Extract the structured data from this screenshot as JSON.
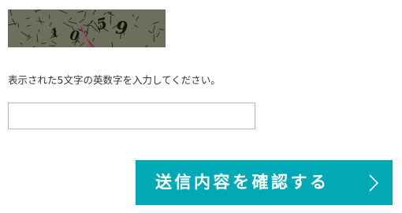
{
  "captcha": {
    "text": "1059",
    "background_color": "#6e6e5c",
    "noise_color": "#1e1e16",
    "accent_line_color": "#c2185b"
  },
  "form": {
    "instruction": "表示された5文字の英数字を入力してください。",
    "code_value": "",
    "code_placeholder": "",
    "submit_label": "送信内容を確認する",
    "submit_icon": "chevron-right-icon"
  },
  "colors": {
    "button_bg": "#00a9b5",
    "button_text": "#ffffff",
    "input_border": "#b4b4b4",
    "text": "#333333"
  }
}
